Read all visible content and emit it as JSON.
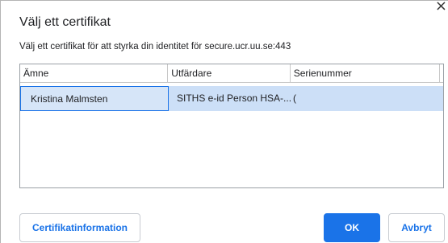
{
  "dialog": {
    "title": "Välj ett certifikat",
    "subtitle": "Välj ett certifikat för att styrka din identitet för secure.ucr.uu.se:443",
    "close_icon": "×"
  },
  "table": {
    "columns": [
      "Ämne",
      "Utfärdare",
      "Serienummer",
      ""
    ],
    "rows": [
      {
        "subject": "Kristina Malmsten",
        "issuer": "SITHS e-id Person HSA-...",
        "serial": "(",
        "extra": "",
        "selected": true
      }
    ]
  },
  "buttons": {
    "info": "Certifikatinformation",
    "ok": "OK",
    "cancel": "Avbryt"
  },
  "colors": {
    "accent": "#1a73e8",
    "selection": "#ccdff7"
  }
}
